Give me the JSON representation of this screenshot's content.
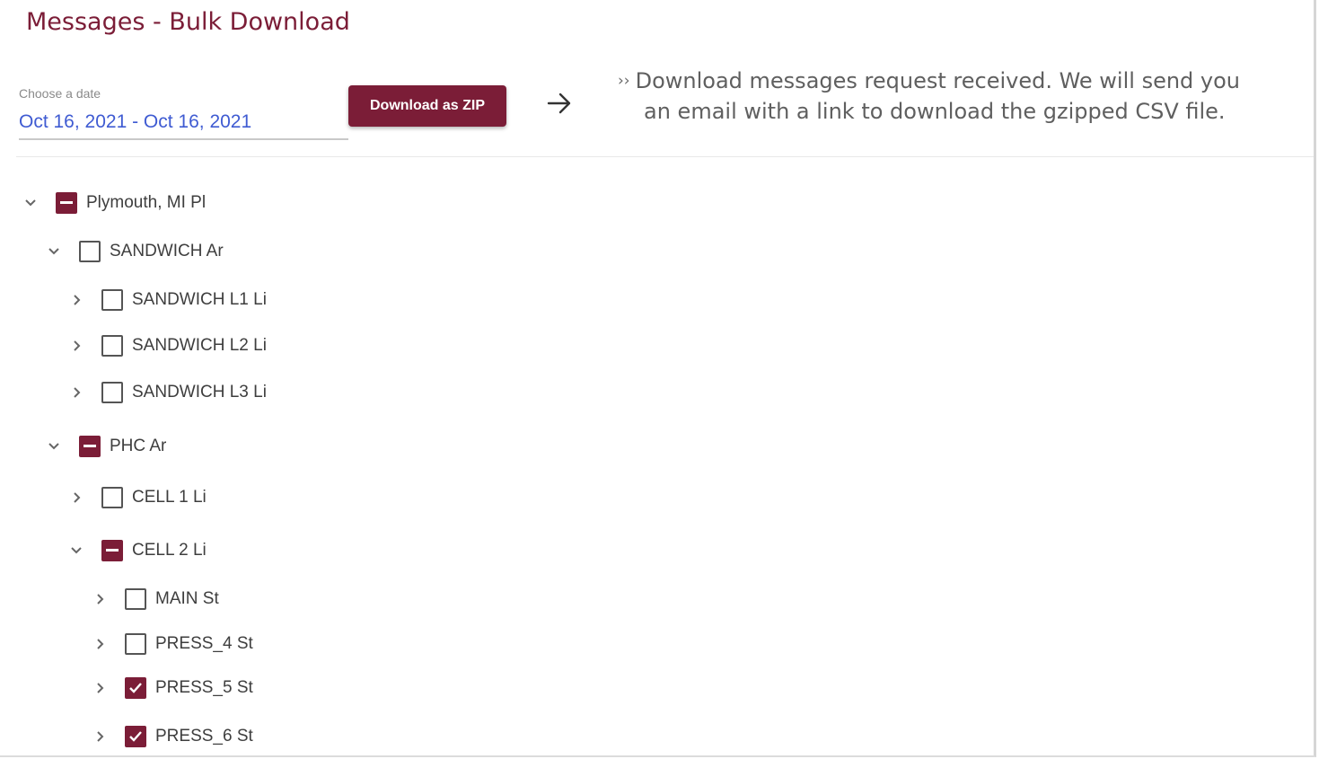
{
  "header": {
    "title": "Messages - Bulk Download"
  },
  "date_picker": {
    "label": "Choose a date",
    "value": "Oct 16, 2021 - Oct 16, 2021"
  },
  "download_button": {
    "label": "Download as ZIP"
  },
  "notice": {
    "prefix": "››",
    "line1": "Download messages request received. We will send you",
    "line2": "an email with a link to download the gzipped CSV file."
  },
  "colors": {
    "brand": "#7b1d37",
    "date_text": "#3f5bd2"
  },
  "tree": [
    {
      "label": "Plymouth, MI Pl",
      "state": "indeterminate",
      "expanded": true
    },
    {
      "label": "SANDWICH Ar",
      "state": "unchecked",
      "expanded": true
    },
    {
      "label": "SANDWICH L1 Li",
      "state": "unchecked",
      "expanded": false
    },
    {
      "label": "SANDWICH L2 Li",
      "state": "unchecked",
      "expanded": false
    },
    {
      "label": "SANDWICH L3 Li",
      "state": "unchecked",
      "expanded": false
    },
    {
      "label": "PHC Ar",
      "state": "indeterminate",
      "expanded": true
    },
    {
      "label": "CELL 1 Li",
      "state": "unchecked",
      "expanded": false
    },
    {
      "label": "CELL 2 Li",
      "state": "indeterminate",
      "expanded": true
    },
    {
      "label": "MAIN St",
      "state": "unchecked",
      "expanded": false
    },
    {
      "label": "PRESS_4 St",
      "state": "unchecked",
      "expanded": false
    },
    {
      "label": "PRESS_5 St",
      "state": "checked",
      "expanded": false
    },
    {
      "label": "PRESS_6 St",
      "state": "checked",
      "expanded": false
    }
  ]
}
